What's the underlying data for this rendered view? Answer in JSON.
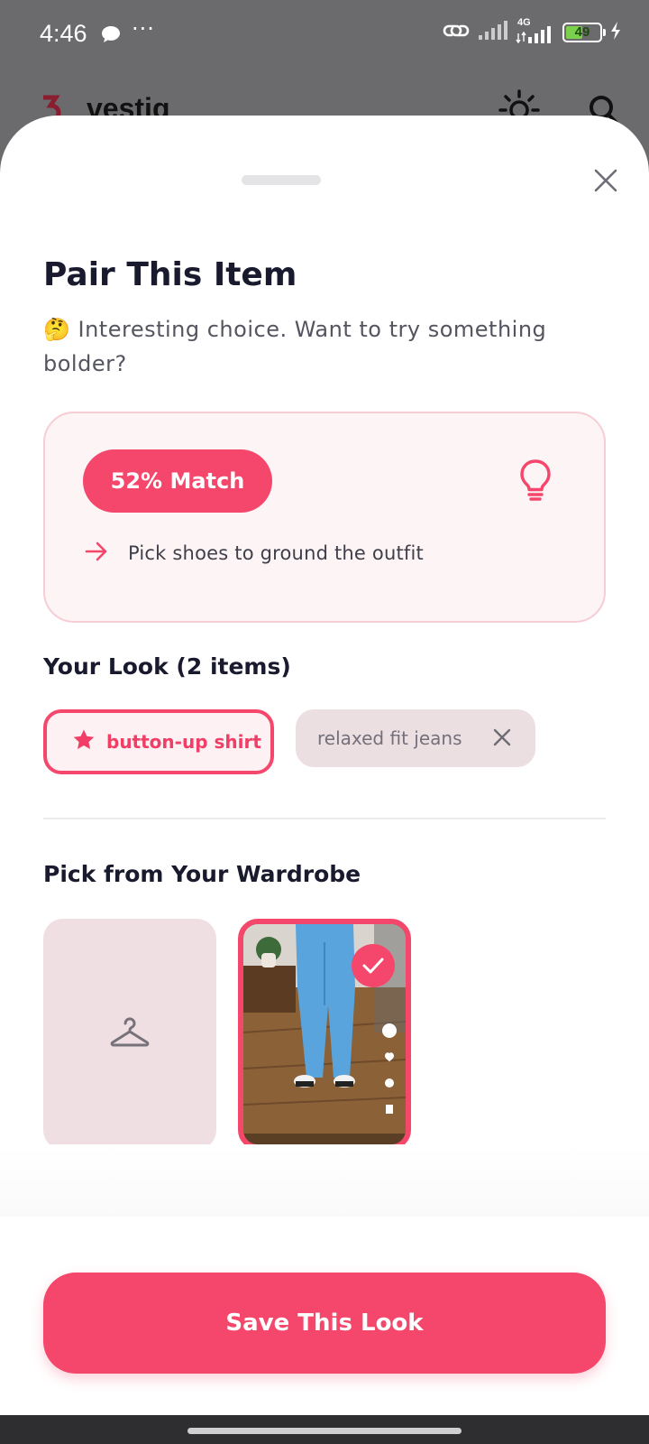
{
  "status_bar": {
    "time": "4:46",
    "dots": "···",
    "network": "4G",
    "battery_percent": "49",
    "battery_level": 0.49
  },
  "app_header": {
    "name": "vestiq"
  },
  "sheet": {
    "title": "Pair This Item",
    "subtitle": "🤔 Interesting choice. Want to try something bolder?",
    "match": {
      "label": "52% Match",
      "tip": "Pick shoes to ground the outfit"
    },
    "look": {
      "title": "Your Look (2 items)",
      "items": [
        {
          "label": "button-up shirt",
          "primary": true
        },
        {
          "label": "relaxed fit jeans",
          "primary": false
        }
      ]
    },
    "wardrobe": {
      "title": "Pick from Your Wardrobe"
    },
    "save_label": "Save This Look"
  },
  "colors": {
    "accent": "#f5476c",
    "card_bg": "#fdf4f5",
    "chip_muted": "#ecdfe2",
    "text_dark": "#1a1a2e"
  }
}
